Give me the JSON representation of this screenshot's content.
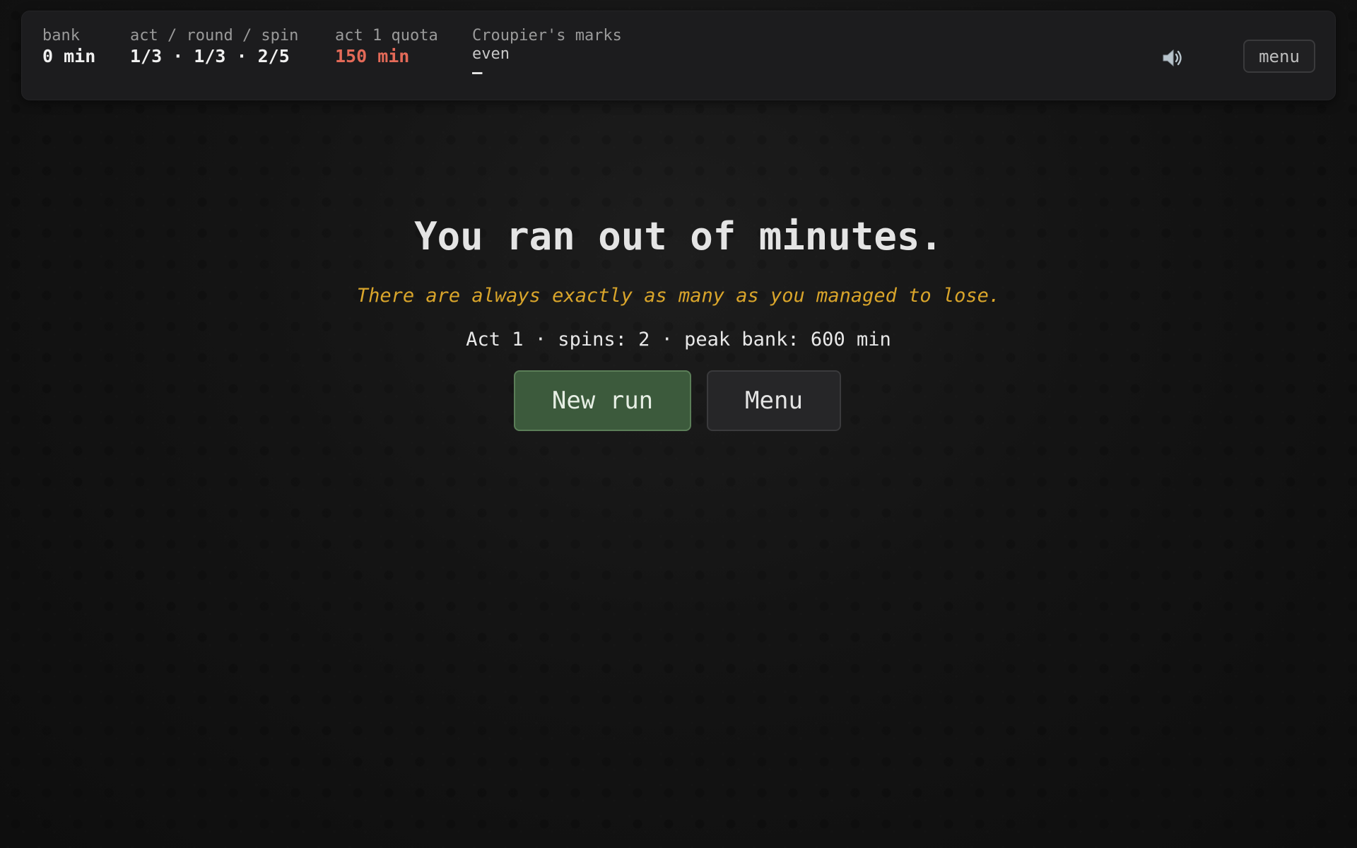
{
  "hud": {
    "bank": {
      "label": "bank",
      "value": "0 min"
    },
    "progress": {
      "label": "act / round / spin",
      "value": "1/3 · 1/3 · 2/5"
    },
    "quota": {
      "label": "act 1 quota",
      "value": "150 min",
      "color": "#e46a58"
    },
    "marks": {
      "label": "Croupier's marks",
      "level": "even",
      "indicator": "—"
    },
    "sound_icon": "speaker-icon",
    "menu_label": "menu"
  },
  "game_over": {
    "headline": "You ran out of minutes.",
    "tagline": "There are always exactly as many as you managed to lose.",
    "summary": "Act 1 · spins: 2 · peak bank: 600 min",
    "new_run_label": "New run",
    "menu_label": "Menu"
  },
  "colors": {
    "accent_gold": "#d9a52b",
    "danger": "#e46a58",
    "new_run_bg": "#3c5a3c"
  }
}
